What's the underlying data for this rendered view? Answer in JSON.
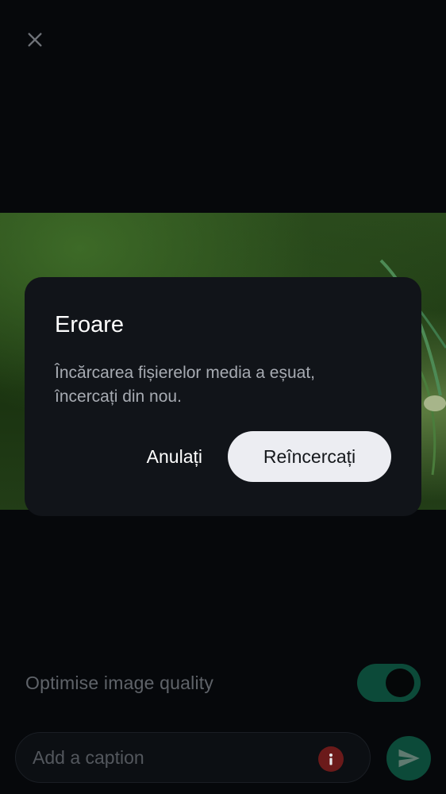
{
  "toolbar": {
    "close_icon": "close-icon"
  },
  "options": {
    "quality_label": "Optimise image quality",
    "quality_enabled": true
  },
  "composer": {
    "caption_placeholder": "Add a caption",
    "error_icon": "info-icon",
    "send_icon": "send-icon"
  },
  "dialog": {
    "title": "Eroare",
    "message": "Încărcarea fișierelor media a eșuat, încercați din nou.",
    "cancel_label": "Anulați",
    "retry_label": "Reîncercați"
  },
  "colors": {
    "background": "#06080b",
    "dialog_background": "#111419",
    "accent_green": "#0c4a39",
    "error_red": "#6b1a1a",
    "retry_button": "#ecedf2"
  }
}
